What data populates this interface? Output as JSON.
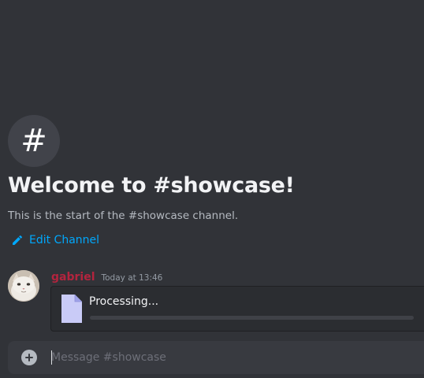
{
  "channel": {
    "icon": "hash-icon",
    "icon_glyph": "#",
    "welcome_title": "Welcome to #showcase!",
    "welcome_subtitle": "This is the start of the #showcase channel.",
    "edit_label": "Edit Channel",
    "edit_icon": "pencil-icon"
  },
  "message": {
    "username": "gabriel",
    "timestamp": "Today at 13:46",
    "avatar": "cat-avatar",
    "attachment": {
      "icon": "file-icon",
      "status": "Processing...",
      "progress": 0
    }
  },
  "composer": {
    "add_icon": "plus-circle-icon",
    "placeholder": "Message #showcase",
    "value": ""
  },
  "colors": {
    "background": "#313338",
    "accent_link": "#00a8fc",
    "username": "#b3243e",
    "file_icon": "#c9cbf7"
  }
}
